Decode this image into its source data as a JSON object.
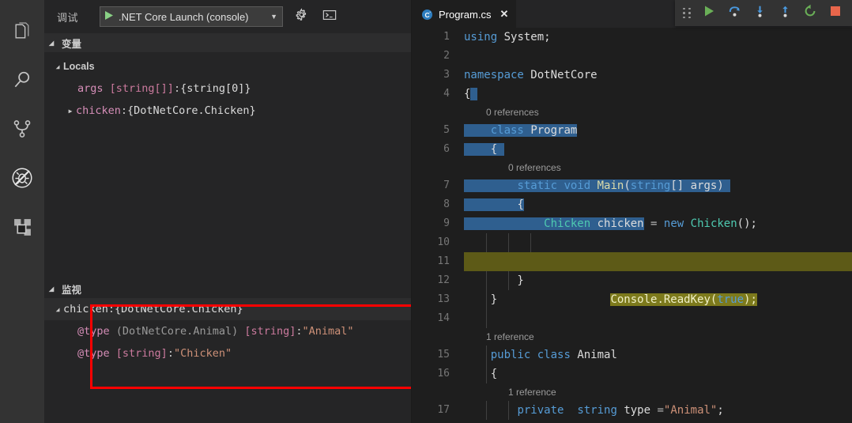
{
  "activity_bar": {
    "items": [
      {
        "name": "explorer",
        "icon": "files-icon"
      },
      {
        "name": "search",
        "icon": "search-icon"
      },
      {
        "name": "source-control",
        "icon": "source-control-icon"
      },
      {
        "name": "run-and-debug",
        "icon": "debug-icon"
      },
      {
        "name": "extensions",
        "icon": "extensions-icon"
      }
    ]
  },
  "debug_panel": {
    "title": "调试",
    "launch_config": ".NET Core Launch (console)",
    "start_icon": "play-icon",
    "dropdown_icon": "chevron-down-icon",
    "settings_icon": "gear-icon",
    "terminal_icon": "open-debug-console-icon",
    "variables_section": {
      "label": "变量",
      "expanded": true,
      "scopes": [
        {
          "label": "Locals",
          "expanded": true,
          "variables": [
            {
              "expandable": false,
              "name": "args",
              "type": "[string[]]",
              "separator": ": ",
              "value": "{string[0]}",
              "value_kind": "object"
            },
            {
              "expandable": true,
              "expanded": false,
              "name": "chicken",
              "type": "",
              "separator": ": ",
              "value": "{DotNetCore.Chicken}",
              "value_kind": "object"
            }
          ]
        }
      ]
    },
    "watch_section": {
      "label": "监视",
      "expanded": true,
      "highlight_color": "#ff0000",
      "entries": [
        {
          "expandable": true,
          "expanded": true,
          "selected": true,
          "name": "chicken",
          "qualifier": "",
          "type": "",
          "separator": ": ",
          "value": "{DotNetCore.Chicken}",
          "value_kind": "object"
        },
        {
          "expandable": false,
          "selected": false,
          "name": "@type",
          "qualifier": "(DotNetCore.Animal)",
          "type": "[string]",
          "separator": ": ",
          "value": "\"Animal\"",
          "value_kind": "string"
        },
        {
          "expandable": false,
          "selected": false,
          "name": "@type",
          "qualifier": "",
          "type": "[string]",
          "separator": ": ",
          "value": "\"Chicken\"",
          "value_kind": "string"
        }
      ]
    }
  },
  "editor": {
    "tab": {
      "filename": "Program.cs",
      "icon": "csharp-file-icon",
      "close_icon": "close-icon",
      "active": true
    },
    "debug_toolbar": {
      "grip_icon": "drag-handle-icon",
      "buttons": [
        {
          "name": "continue-button",
          "icon": "continue-icon",
          "color": "#6aaf57"
        },
        {
          "name": "step-over-button",
          "icon": "step-over-icon",
          "color": "#4a9ae0"
        },
        {
          "name": "step-into-button",
          "icon": "step-into-icon",
          "color": "#4a9ae0"
        },
        {
          "name": "step-out-button",
          "icon": "step-out-icon",
          "color": "#4a9ae0"
        },
        {
          "name": "restart-button",
          "icon": "restart-icon",
          "color": "#6aaf57"
        },
        {
          "name": "stop-button",
          "icon": "stop-icon",
          "color": "#e8664b"
        }
      ]
    },
    "breakpoint_line": 9,
    "current_execution_line": 11,
    "lines": [
      {
        "num": "1",
        "text": "using System;"
      },
      {
        "num": "2",
        "text": ""
      },
      {
        "num": "3",
        "text": "namespace DotNetCore"
      },
      {
        "num": "4",
        "text": "{"
      },
      {
        "lens": "0 references"
      },
      {
        "num": "5",
        "text": "    class Program"
      },
      {
        "num": "6",
        "text": "    {"
      },
      {
        "lens": "0 references"
      },
      {
        "num": "7",
        "text": "        static void Main(string[] args)"
      },
      {
        "num": "8",
        "text": "        {"
      },
      {
        "num": "9",
        "text": "            Chicken chicken = new Chicken();"
      },
      {
        "num": "10",
        "text": ""
      },
      {
        "num": "11",
        "text": "            Console.ReadKey(true);"
      },
      {
        "num": "12",
        "text": "        }"
      },
      {
        "num": "13",
        "text": "    }"
      },
      {
        "num": "14",
        "text": ""
      },
      {
        "lens": "1 reference"
      },
      {
        "num": "15",
        "text": "    public class Animal"
      },
      {
        "num": "16",
        "text": "    {"
      },
      {
        "lens": "1 reference"
      },
      {
        "num": "17",
        "text": "        private  string type =\"Animal\";"
      }
    ]
  }
}
